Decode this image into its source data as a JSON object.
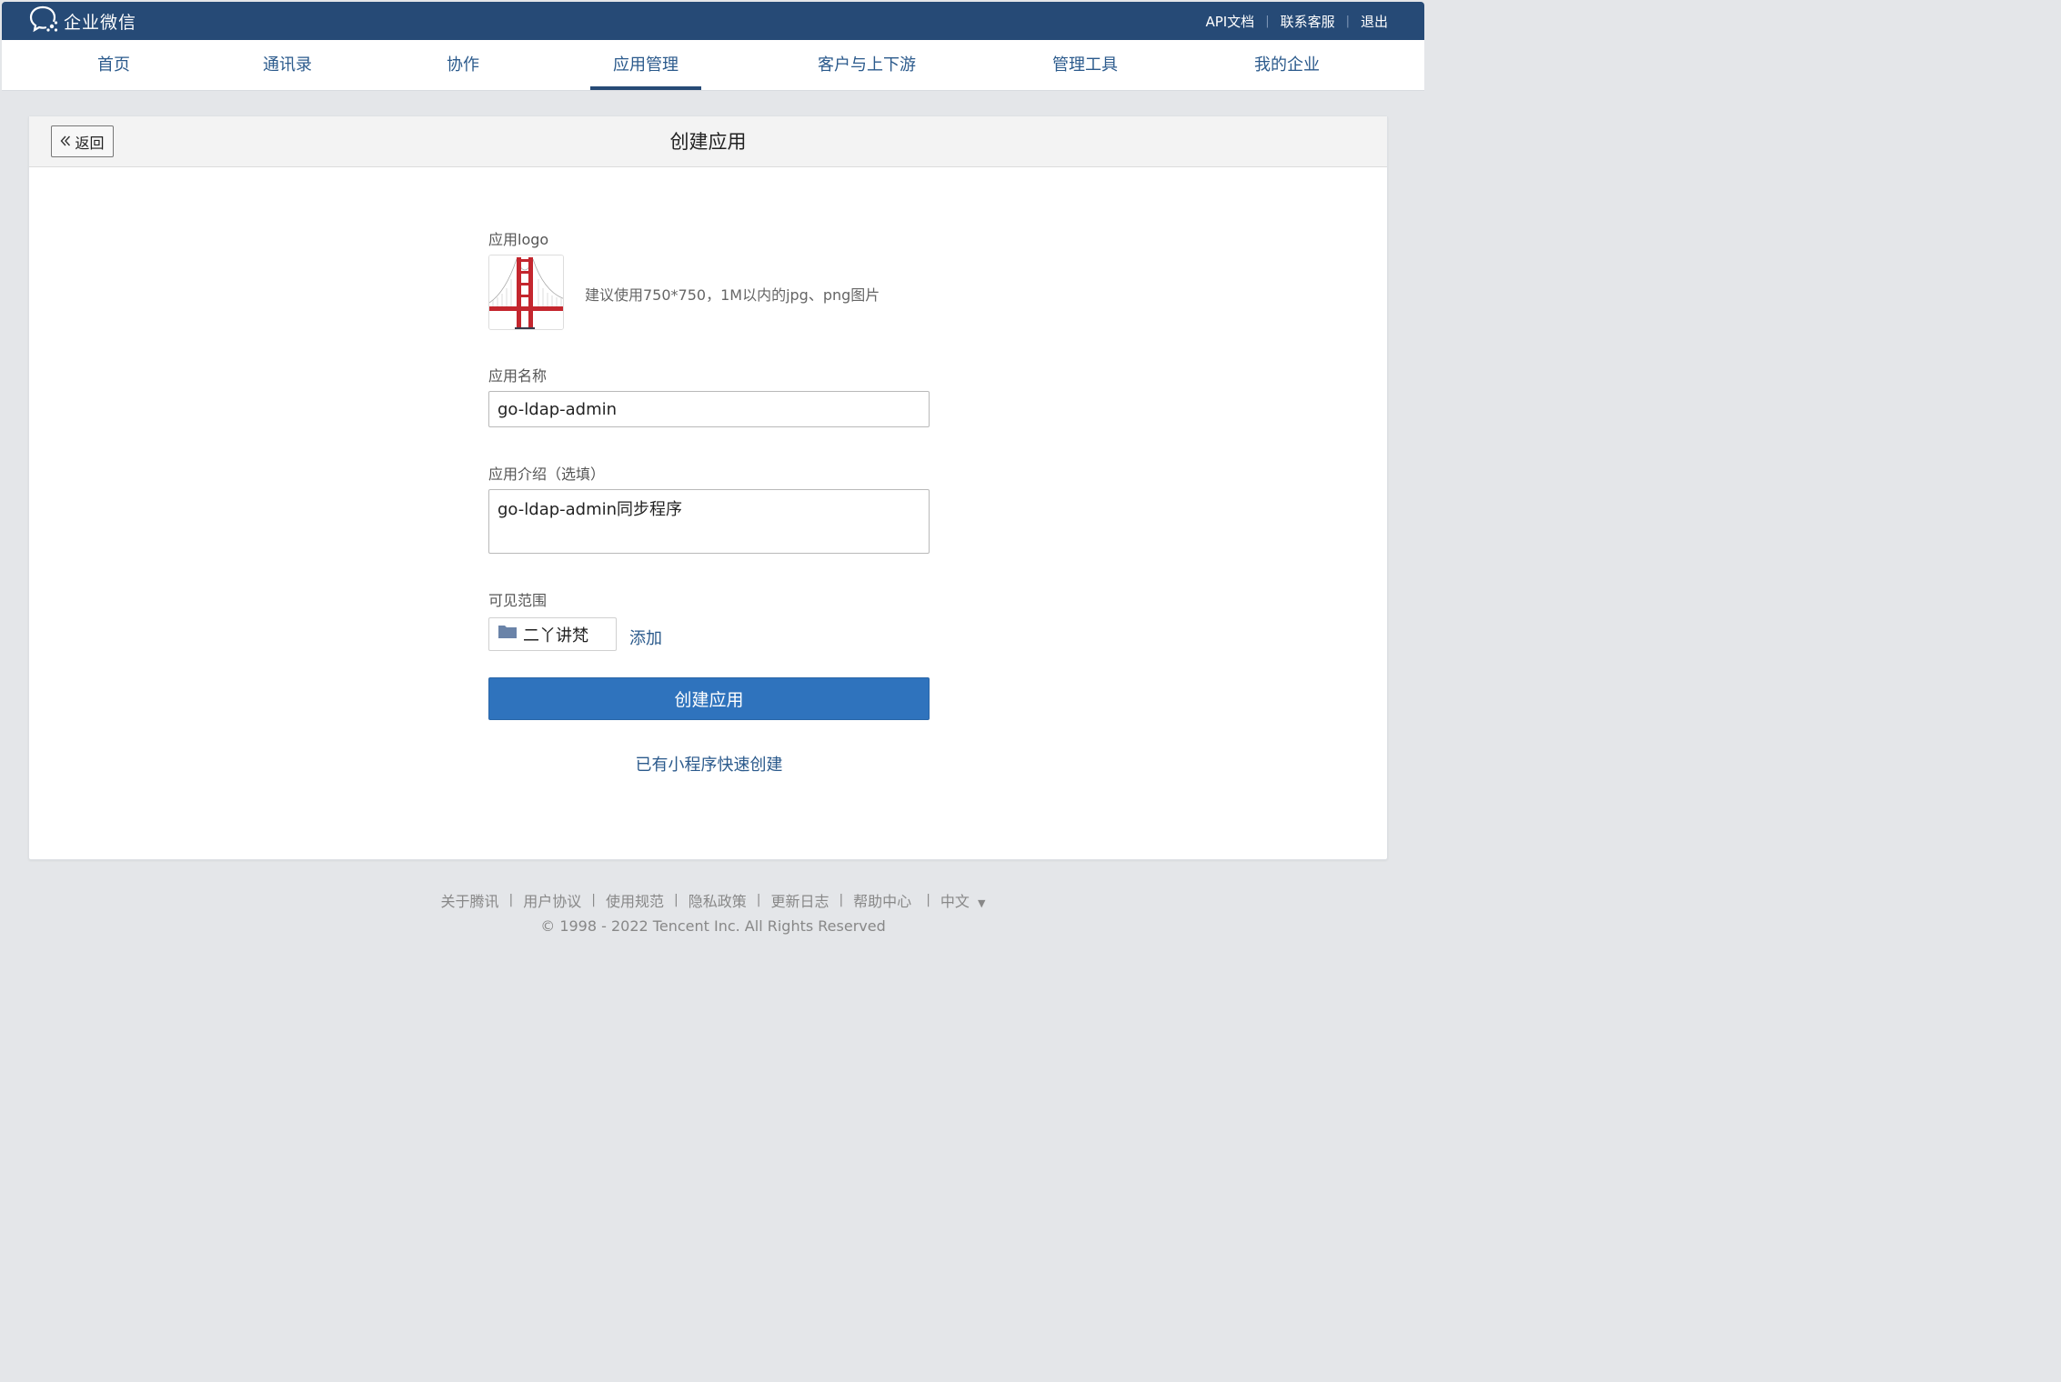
{
  "topbar": {
    "brand_icon": "wecom-chat-icon",
    "brand": "企业微信",
    "links": [
      "API文档",
      "联系客服",
      "退出"
    ]
  },
  "nav": {
    "items": [
      "首页",
      "通讯录",
      "协作",
      "应用管理",
      "客户与上下游",
      "管理工具",
      "我的企业"
    ],
    "active": "应用管理"
  },
  "page": {
    "back_label": "返回",
    "back_icon": "double-chevron-left-icon",
    "title": "创建应用"
  },
  "form": {
    "logo_label": "应用logo",
    "logo_image": "golden-gate-bridge-logo",
    "logo_hint": "建议使用750*750，1M以内的jpg、png图片",
    "name_label": "应用名称",
    "name_value": "go-ldap-admin",
    "intro_label": "应用介绍（选填）",
    "intro_value": "go-ldap-admin同步程序",
    "scope_label": "可见范围",
    "scope_tag": "二丫讲梵",
    "scope_tag_icon": "folder-icon",
    "add_label": "添加",
    "submit_label": "创建应用",
    "quick_create_label": "已有小程序快速创建"
  },
  "footer": {
    "links": [
      "关于腾讯",
      "用户协议",
      "使用规范",
      "隐私政策",
      "更新日志",
      "帮助中心"
    ],
    "language": "中文",
    "language_icon": "triangle-down-icon",
    "copyright": "© 1998 - 2022 Tencent Inc. All Rights Reserved"
  },
  "colors": {
    "topbar": "#264a76",
    "link": "#2b5a8c",
    "primary_button": "#2f73bd",
    "background": "#e4e6e9"
  }
}
